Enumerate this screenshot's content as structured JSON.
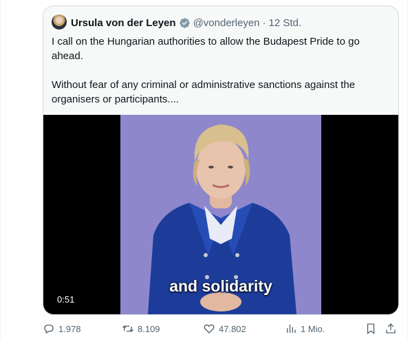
{
  "tweet": {
    "author_name": "Ursula von der Leyen",
    "handle": "@vonderleyen",
    "separator": "·",
    "time": "12 Std.",
    "text_paragraphs": [
      "I call on the Hungarian authorities to allow the Budapest Pride to go ahead.",
      "Without fear of any criminal or administrative sanctions against the organisers or participants...."
    ]
  },
  "video": {
    "caption": "and solidarity",
    "duration": "0:51"
  },
  "actions": {
    "replies": "1.978",
    "reposts": "8.109",
    "likes": "47.802",
    "views": "1 Mio."
  },
  "icons": {
    "verified": "verified-badge-icon",
    "reply": "reply-icon",
    "repost": "repost-icon",
    "like": "heart-icon",
    "views": "views-icon",
    "bookmark": "bookmark-icon",
    "share": "share-icon"
  },
  "colors": {
    "verified_badge": "#829aab",
    "secondary_text": "#536471",
    "border": "#cfd9de"
  }
}
